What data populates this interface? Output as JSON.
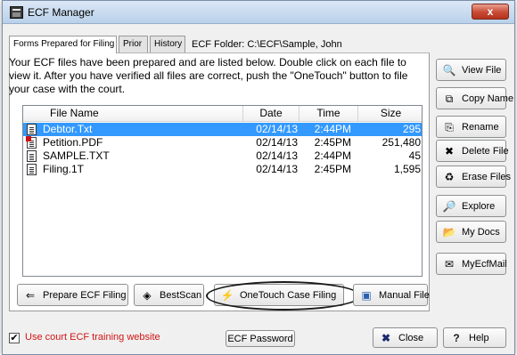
{
  "window": {
    "title": "ECF Manager",
    "close_glyph": "x"
  },
  "tabs": [
    {
      "label": "Forms Prepared for Filing"
    },
    {
      "label": "Prior"
    },
    {
      "label": "History"
    }
  ],
  "folder": "ECF Folder:  C:\\ECF\\Sample, John",
  "intro": "Your ECF files have been prepared and are listed below. Double click on each file to view it. After you have verified all files are correct, push the \"OneTouch\" button to file your case with the court.",
  "columns": {
    "name": "File Name",
    "date": "Date",
    "time": "Time",
    "size": "Size"
  },
  "files": [
    {
      "name": "Debtor.Txt",
      "date": "02/14/13",
      "time": "2:44PM",
      "size": "295",
      "icon": "text-file-icon"
    },
    {
      "name": "Petition.PDF",
      "date": "02/14/13",
      "time": "2:45PM",
      "size": "251,480",
      "icon": "pdf-file-icon"
    },
    {
      "name": "SAMPLE.TXT",
      "date": "02/14/13",
      "time": "2:44PM",
      "size": "45",
      "icon": "text-file-icon"
    },
    {
      "name": "Filing.1T",
      "date": "02/14/13",
      "time": "2:45PM",
      "size": "1,595",
      "icon": "text-file-icon"
    }
  ],
  "selected_row": 0,
  "side_buttons": [
    {
      "label": "View File",
      "icon": "view-icon",
      "glyph": "🔍"
    },
    {
      "label": "Copy Name",
      "icon": "copy-icon",
      "glyph": "⧉"
    },
    {
      "label": "Rename",
      "icon": "rename-icon",
      "glyph": "⎘"
    },
    {
      "label": "Delete File",
      "icon": "delete-icon",
      "glyph": "✖"
    },
    {
      "label": "Erase Files",
      "icon": "erase-icon",
      "glyph": "♻"
    },
    {
      "label": "Explore",
      "icon": "explore-icon",
      "glyph": "🔎"
    },
    {
      "label": "My Docs",
      "icon": "folder-icon",
      "glyph": "📂"
    },
    {
      "label": "MyEcfMail",
      "icon": "mail-icon",
      "glyph": "✉"
    }
  ],
  "bottom_buttons": {
    "prepare": {
      "label": "Prepare ECF Filing",
      "icon": "prepare-icon",
      "glyph": "⇐"
    },
    "bestscan": {
      "label": "BestScan",
      "icon": "scan-icon",
      "glyph": "◈"
    },
    "onetouch": {
      "label": "OneTouch Case Filing",
      "icon": "lightning-icon",
      "glyph": "⚡"
    },
    "manual": {
      "label": "Manual File",
      "icon": "manual-icon",
      "glyph": "▣"
    }
  },
  "footer": {
    "checkbox_label": "Use court ECF training website",
    "checkbox_checked": true,
    "password_label": "ECF Password",
    "close_label": "Close",
    "help_label": "Help"
  },
  "colors": {
    "selection": "#3399ff",
    "warning_text": "#d21414",
    "title_bar": "#b9d1ea"
  }
}
